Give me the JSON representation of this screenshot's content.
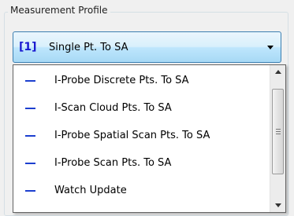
{
  "group": {
    "title": "Measurement Profile"
  },
  "combo": {
    "index": "[1]",
    "selected": "Single Pt. To SA"
  },
  "dropdown": {
    "items": [
      {
        "label": "I-Probe Discrete Pts. To SA"
      },
      {
        "label": "I-Scan Cloud Pts. To SA"
      },
      {
        "label": "I-Probe Spatial Scan Pts. To SA"
      },
      {
        "label": "I-Probe Scan Pts. To SA"
      },
      {
        "label": "Watch Update"
      }
    ]
  },
  "colors": {
    "accent": "#1c3fcf",
    "combo_border": "#3c7fb1",
    "index": "#1a1ad0"
  },
  "icons": {
    "item_marker": "dash-icon",
    "combo_arrow": "chevron-down-icon"
  }
}
